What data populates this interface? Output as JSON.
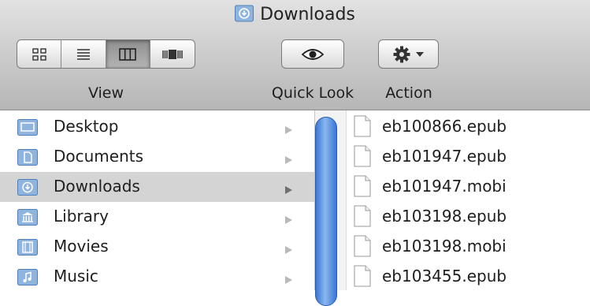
{
  "window": {
    "title": "Downloads",
    "title_icon": "downloads-folder-icon"
  },
  "toolbar": {
    "view_label": "View",
    "view_modes": [
      {
        "name": "icon-view",
        "icon": "grid-icon",
        "active": false
      },
      {
        "name": "list-view",
        "icon": "list-icon",
        "active": false
      },
      {
        "name": "column-view",
        "icon": "columns-icon",
        "active": true
      },
      {
        "name": "cover-flow-view",
        "icon": "coverflow-icon",
        "active": false
      }
    ],
    "quick_look_label": "Quick Look",
    "action_label": "Action"
  },
  "sidebar_column": {
    "items": [
      {
        "label": "Desktop",
        "icon": "desktop-folder-icon",
        "selected": false
      },
      {
        "label": "Documents",
        "icon": "documents-folder-icon",
        "selected": false
      },
      {
        "label": "Downloads",
        "icon": "downloads-folder-icon",
        "selected": true
      },
      {
        "label": "Library",
        "icon": "library-folder-icon",
        "selected": false
      },
      {
        "label": "Movies",
        "icon": "movies-folder-icon",
        "selected": false
      },
      {
        "label": "Music",
        "icon": "music-folder-icon",
        "selected": false
      }
    ]
  },
  "files_column": {
    "items": [
      {
        "label": "eb100866.epub"
      },
      {
        "label": "eb101947.epub"
      },
      {
        "label": "eb101947.mobi"
      },
      {
        "label": "eb103198.epub"
      },
      {
        "label": "eb103198.mobi"
      },
      {
        "label": "eb103455.epub"
      }
    ]
  },
  "colors": {
    "selection": "#d4d4d4",
    "folder": "#8fb4dd",
    "scroll_thumb": "#4d88e0"
  }
}
